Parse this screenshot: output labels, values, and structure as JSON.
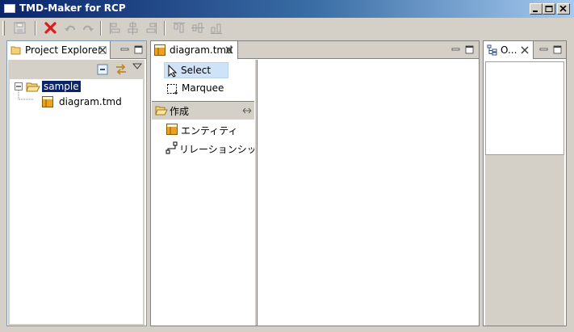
{
  "window": {
    "title": "TMD-Maker for RCP"
  },
  "toolbar": {
    "icons": [
      "save-icon",
      "delete-icon",
      "undo-icon",
      "redo-icon",
      "align-left-icon",
      "align-center-icon",
      "align-right-icon",
      "align-top-icon",
      "align-middle-icon",
      "align-bottom-icon"
    ]
  },
  "project_explorer": {
    "tab_label": "Project Explorer",
    "tree": {
      "root": "sample",
      "child": "diagram.tmd"
    }
  },
  "editor": {
    "tab_label": "diagram.tmd",
    "palette": {
      "select_label": "Select",
      "marquee_label": "Marquee",
      "drawer_label": "作成",
      "entity_label": "エンティティ",
      "relationship_label": "リレーションシップ"
    }
  },
  "outline": {
    "tab_label": "O..."
  },
  "colors": {
    "titlebar_start": "#0a246a",
    "titlebar_end": "#a6caf0",
    "window_bg": "#d4d0c8",
    "selection": "#0a246a",
    "palette_selected": "#cfe3f8",
    "delete_red": "#d81e1e",
    "entity_orange": "#f0a020"
  }
}
